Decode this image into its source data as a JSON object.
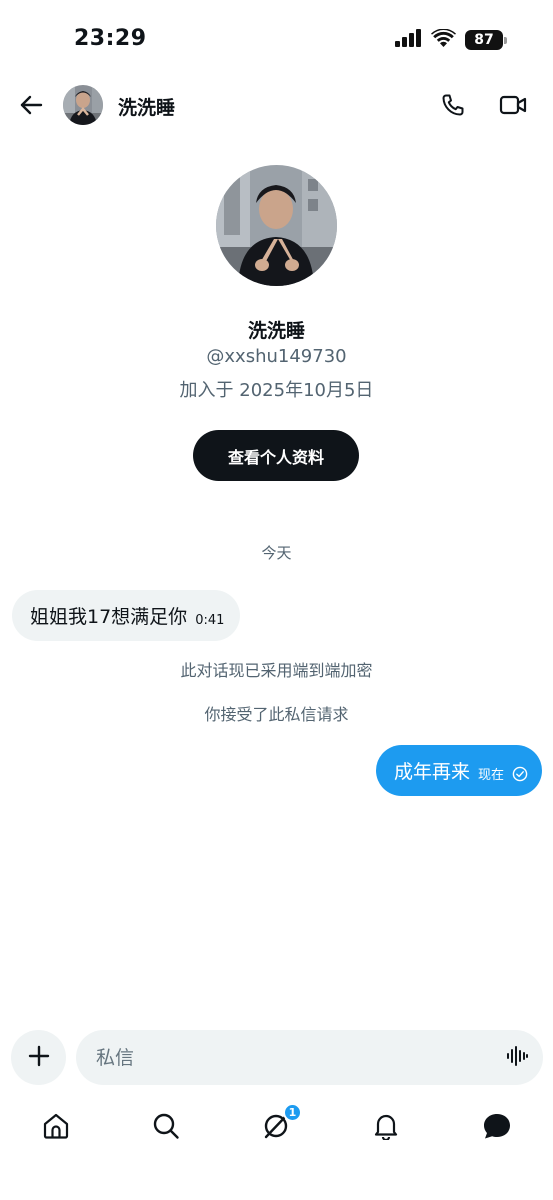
{
  "status_bar": {
    "time": "23:29",
    "battery": "87",
    "icons": [
      "cellular-signal-icon",
      "wifi-icon",
      "battery-icon"
    ]
  },
  "header": {
    "name": "洗洗睡",
    "icons": [
      "back-arrow-icon",
      "phone-icon",
      "video-icon"
    ]
  },
  "profile": {
    "name": "洗洗睡",
    "handle": "@xxshu149730",
    "joined": "加入于 2025年10月5日",
    "view_profile_label": "查看个人资料"
  },
  "conversation": {
    "date_divider": "今天",
    "incoming": {
      "text": "姐姐我17想满足你",
      "time": "0:41"
    },
    "system_messages": [
      "此对话现已采用端到端加密",
      "你接受了此私信请求"
    ],
    "outgoing": {
      "text": "成年再来",
      "time": "现在",
      "status_icon": "read-check-icon"
    }
  },
  "composer": {
    "placeholder": "私信",
    "icons": [
      "plus-icon",
      "voice-wave-icon"
    ]
  },
  "tab_bar": {
    "tabs": [
      "home-icon",
      "search-icon",
      "grok-icon",
      "bell-icon",
      "messages-icon"
    ],
    "badge_count": "1"
  },
  "colors": {
    "accent": "#1d9bf0",
    "text_primary": "#0f1419",
    "text_secondary": "#536471",
    "bubble_incoming": "#eff3f4",
    "button_dark": "#0f1419"
  }
}
